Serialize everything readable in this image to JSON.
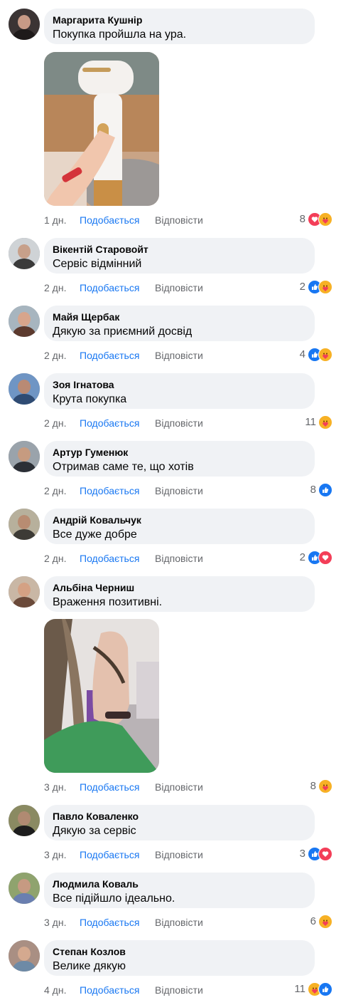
{
  "actions": {
    "like_label": "Подобається",
    "reply_label": "Відповісти"
  },
  "colors": {
    "accent": "#1877f2",
    "bubble": "#f0f2f5",
    "meta_text": "#65676b",
    "like_reaction": "#1877f2",
    "love_reaction": "#f33e58",
    "care_reaction": "#f7b125"
  },
  "comments": [
    {
      "author": "Маргарита Кушнір",
      "text": "Покупка пройшла на ура.",
      "time": "1 дн.",
      "reactions_count": "8",
      "reactions": [
        "love-icon",
        "care-icon"
      ],
      "has_photo": true,
      "photo": "photo of hand holding white hair dryer"
    },
    {
      "author": "Вікентій Старовойт",
      "text": "Сервіс відмінний",
      "time": "2 дн.",
      "reactions_count": "2",
      "reactions": [
        "like-icon",
        "care-icon"
      ]
    },
    {
      "author": "Майя Щербак",
      "text": "Дякую за приємний досвід",
      "time": "2 дн.",
      "reactions_count": "4",
      "reactions": [
        "like-icon",
        "care-icon"
      ]
    },
    {
      "author": "Зоя Ігнатова",
      "text": "Крута покупка",
      "time": "2 дн.",
      "reactions_count": "11",
      "reactions": [
        "care-icon"
      ]
    },
    {
      "author": "Артур Гуменюк",
      "text": "Отримав саме те, що хотів",
      "time": "2 дн.",
      "reactions_count": "8",
      "reactions": [
        "like-icon"
      ]
    },
    {
      "author": "Андрій Ковальчук",
      "text": "Все дуже добре",
      "time": "2 дн.",
      "reactions_count": "2",
      "reactions": [
        "like-icon",
        "love-icon"
      ]
    },
    {
      "author": "Альбіна Черниш",
      "text": "Враження позитивні.",
      "time": "3 дн.",
      "reactions_count": "8",
      "reactions": [
        "care-icon"
      ],
      "has_photo": true,
      "photo": "photo of hand holding strand of hair"
    },
    {
      "author": "Павло Коваленко",
      "text": "Дякую за сервіс",
      "time": "3 дн.",
      "reactions_count": "3",
      "reactions": [
        "like-icon",
        "love-icon"
      ]
    },
    {
      "author": "Людмила Коваль",
      "text": "Все підійшло ідеально.",
      "time": "3 дн.",
      "reactions_count": "6",
      "reactions": [
        "care-icon"
      ]
    },
    {
      "author": "Степан Козлов",
      "text": "Велике дякую",
      "time": "4 дн.",
      "reactions_count": "11",
      "reactions": [
        "care-icon",
        "like-icon"
      ]
    }
  ]
}
